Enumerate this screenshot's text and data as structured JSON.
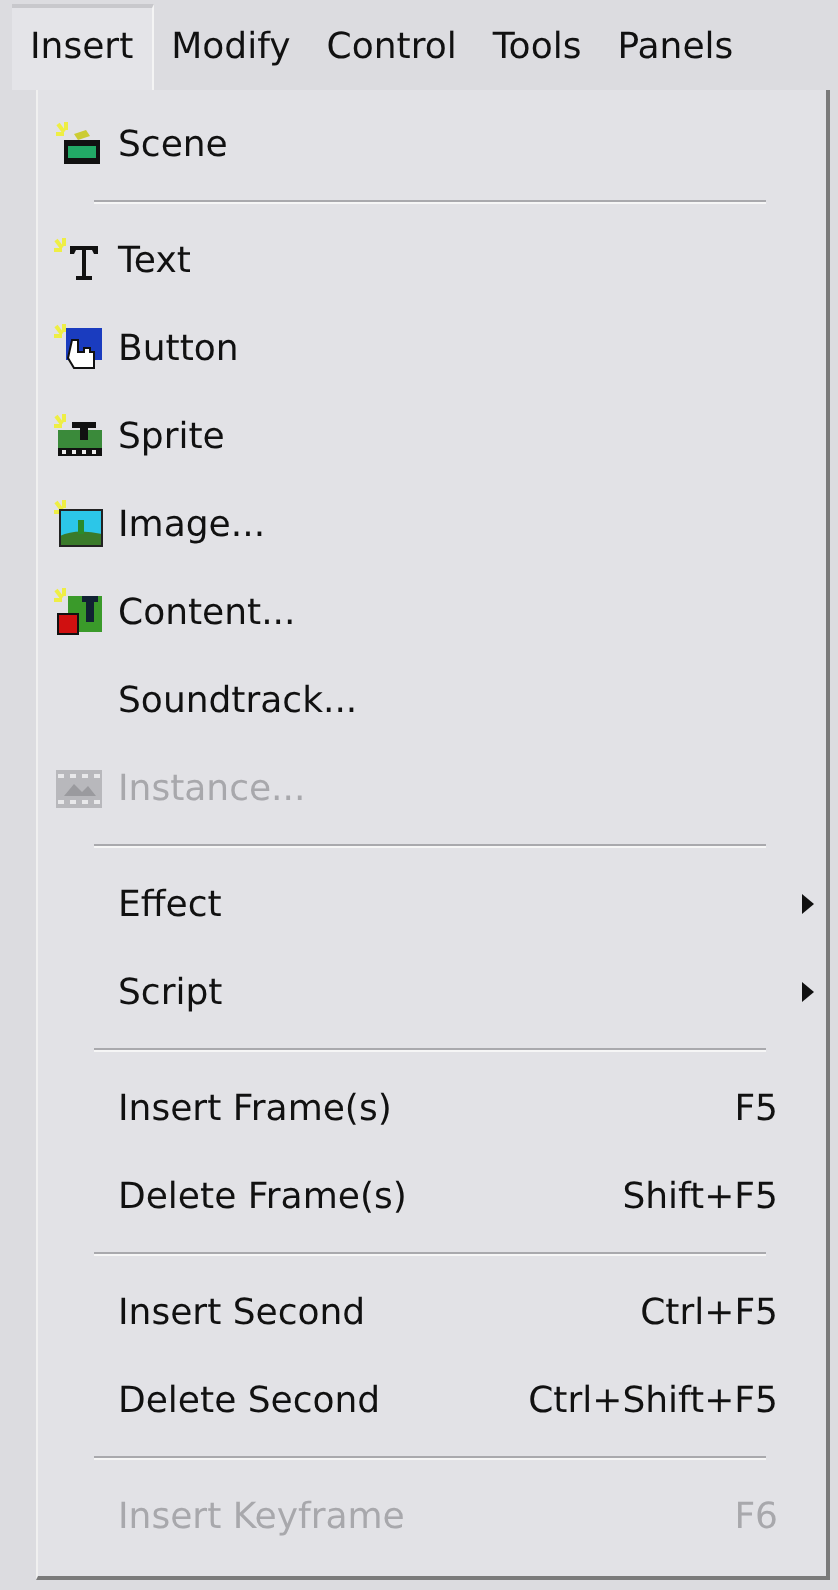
{
  "menu_bar": [
    {
      "label": "Insert",
      "selected": true
    },
    {
      "label": "Modify",
      "selected": false
    },
    {
      "label": "Control",
      "selected": false
    },
    {
      "label": "Tools",
      "selected": false
    },
    {
      "label": "Panels",
      "selected": false
    }
  ],
  "menu": [
    {
      "kind": "item",
      "label": "Scene",
      "disabled": false
    },
    {
      "kind": "separator"
    },
    {
      "kind": "item",
      "label": "Text",
      "disabled": false
    },
    {
      "kind": "item",
      "label": "Button",
      "disabled": false
    },
    {
      "kind": "item",
      "label": "Sprite",
      "disabled": false
    },
    {
      "kind": "item",
      "label": "Image...",
      "disabled": false
    },
    {
      "kind": "item",
      "label": "Content...",
      "disabled": false
    },
    {
      "kind": "item",
      "label": "Soundtrack...",
      "disabled": false
    },
    {
      "kind": "item",
      "label": "Instance...",
      "disabled": true
    },
    {
      "kind": "separator"
    },
    {
      "kind": "item",
      "label": "Effect",
      "submenu": true,
      "disabled": false
    },
    {
      "kind": "item",
      "label": "Script",
      "submenu": true,
      "disabled": false
    },
    {
      "kind": "separator"
    },
    {
      "kind": "item",
      "label": "Insert Frame(s)",
      "shortcut": "F5",
      "disabled": false
    },
    {
      "kind": "item",
      "label": "Delete Frame(s)",
      "shortcut": "Shift+F5",
      "disabled": false
    },
    {
      "kind": "separator"
    },
    {
      "kind": "item",
      "label": "Insert Second",
      "shortcut": "Ctrl+F5",
      "disabled": false
    },
    {
      "kind": "item",
      "label": "Delete Second",
      "shortcut": "Ctrl+Shift+F5",
      "disabled": false
    },
    {
      "kind": "separator"
    },
    {
      "kind": "item",
      "label": "Insert Keyframe",
      "shortcut": "F6",
      "disabled": true
    }
  ]
}
